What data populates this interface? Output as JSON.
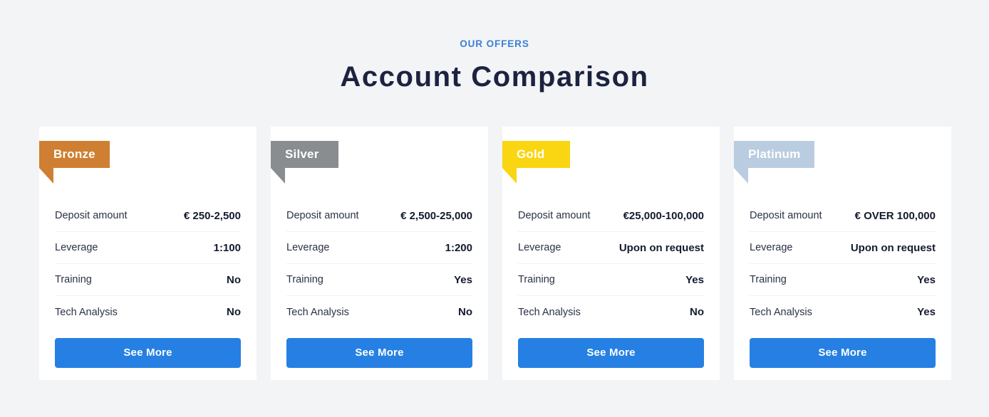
{
  "header": {
    "eyebrow": "OUR OFFERS",
    "title": "Account Comparison"
  },
  "colors": {
    "page_background": "#f2f4f6",
    "card_background": "#ffffff",
    "accent_blue": "#2680e3",
    "eyebrow_blue": "#3a7fd5",
    "title_navy": "#1c2340",
    "divider": "#f0f1f3"
  },
  "row_labels": {
    "deposit": "Deposit amount",
    "leverage": "Leverage",
    "training": "Training",
    "tech_analysis": "Tech Analysis"
  },
  "cards": [
    {
      "name": "Bronze",
      "ribbon_color": "#cf7f31",
      "rows": [
        {
          "label": "Deposit amount",
          "value": "€ 250-2,500"
        },
        {
          "label": "Leverage",
          "value": "1:100"
        },
        {
          "label": "Training",
          "value": "No"
        },
        {
          "label": "Tech Analysis",
          "value": "No"
        }
      ],
      "button_label": "See More"
    },
    {
      "name": "Silver",
      "ribbon_color": "#8a8d90",
      "rows": [
        {
          "label": "Deposit amount",
          "value": "€ 2,500-25,000"
        },
        {
          "label": "Leverage",
          "value": "1:200"
        },
        {
          "label": "Training",
          "value": "Yes"
        },
        {
          "label": "Tech Analysis",
          "value": "No"
        }
      ],
      "button_label": "See More"
    },
    {
      "name": "Gold",
      "ribbon_color": "#fad512",
      "rows": [
        {
          "label": "Deposit amount",
          "value": "€25,000-100,000"
        },
        {
          "label": "Leverage",
          "value": "Upon on request"
        },
        {
          "label": "Training",
          "value": "Yes"
        },
        {
          "label": "Tech Analysis",
          "value": "No"
        }
      ],
      "button_label": "See More"
    },
    {
      "name": "Platinum",
      "ribbon_color": "#bacce0",
      "rows": [
        {
          "label": "Deposit amount",
          "value": "€ OVER 100,000"
        },
        {
          "label": "Leverage",
          "value": "Upon on request"
        },
        {
          "label": "Training",
          "value": "Yes"
        },
        {
          "label": "Tech Analysis",
          "value": "Yes"
        }
      ],
      "button_label": "See More"
    }
  ]
}
